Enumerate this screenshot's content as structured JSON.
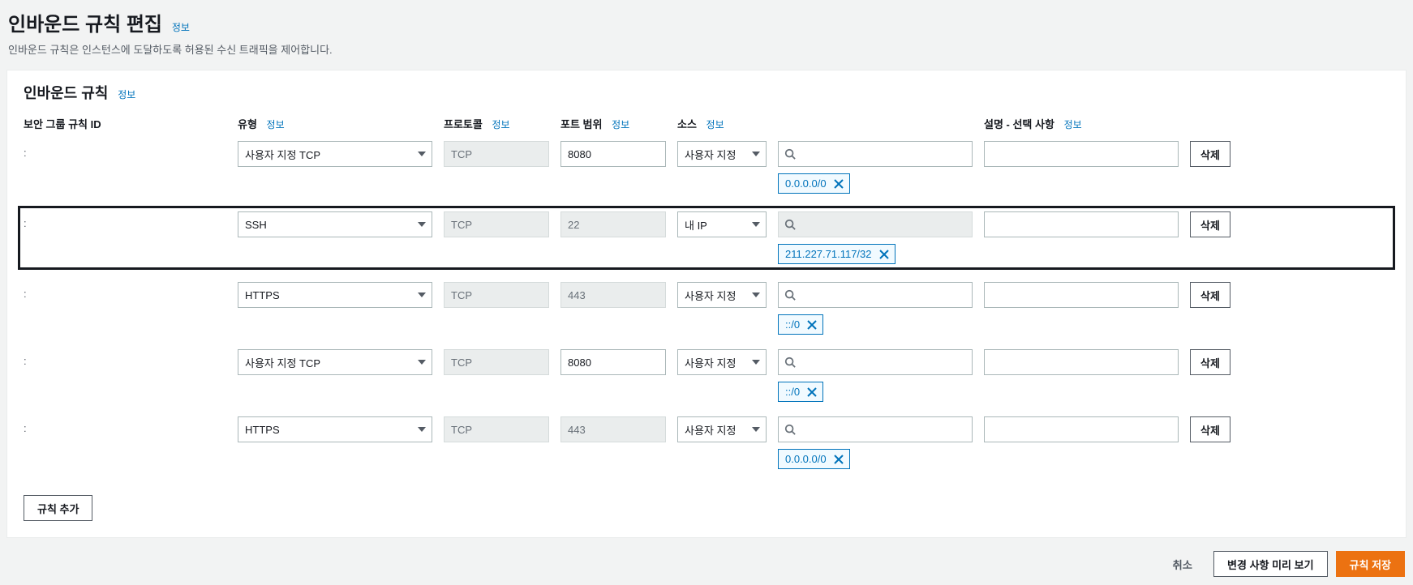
{
  "header": {
    "title": "인바운드 규칙 편집",
    "info": "정보",
    "desc": "인바운드 규칙은 인스턴스에 도달하도록 허용된 수신 트래픽을 제어합니다."
  },
  "panel": {
    "title": "인바운드 규칙",
    "info": "정보"
  },
  "columns": {
    "rule_id": "보안 그룹 규칙 ID",
    "type": "유형",
    "protocol": "프로토콜",
    "port": "포트 범위",
    "source": "소스",
    "desc": "설명 - 선택 사항",
    "info": "정보"
  },
  "rules": [
    {
      "id": ":",
      "type": "사용자 지정 TCP",
      "protocol": "TCP",
      "protocol_disabled": true,
      "port": "8080",
      "port_disabled": false,
      "source_mode": "사용자 지정",
      "search_disabled": false,
      "tag": "0.0.0.0/0",
      "desc": "",
      "highlighted": false
    },
    {
      "id": ":",
      "type": "SSH",
      "protocol": "TCP",
      "protocol_disabled": true,
      "port": "22",
      "port_disabled": true,
      "source_mode": "내 IP",
      "search_disabled": true,
      "tag": "211.227.71.117/32",
      "desc": "",
      "highlighted": true
    },
    {
      "id": ":",
      "type": "HTTPS",
      "protocol": "TCP",
      "protocol_disabled": true,
      "port": "443",
      "port_disabled": true,
      "source_mode": "사용자 지정",
      "search_disabled": false,
      "tag": "::/0",
      "desc": "",
      "highlighted": false
    },
    {
      "id": ":",
      "type": "사용자 지정 TCP",
      "protocol": "TCP",
      "protocol_disabled": true,
      "port": "8080",
      "port_disabled": false,
      "source_mode": "사용자 지정",
      "search_disabled": false,
      "tag": "::/0",
      "desc": "",
      "highlighted": false
    },
    {
      "id": ":",
      "type": "HTTPS",
      "protocol": "TCP",
      "protocol_disabled": true,
      "port": "443",
      "port_disabled": true,
      "source_mode": "사용자 지정",
      "search_disabled": false,
      "tag": "0.0.0.0/0",
      "desc": "",
      "highlighted": false
    }
  ],
  "buttons": {
    "delete": "삭제",
    "add_rule": "규칙 추가",
    "cancel": "취소",
    "preview": "변경 사항 미리 보기",
    "save": "규칙 저장"
  }
}
